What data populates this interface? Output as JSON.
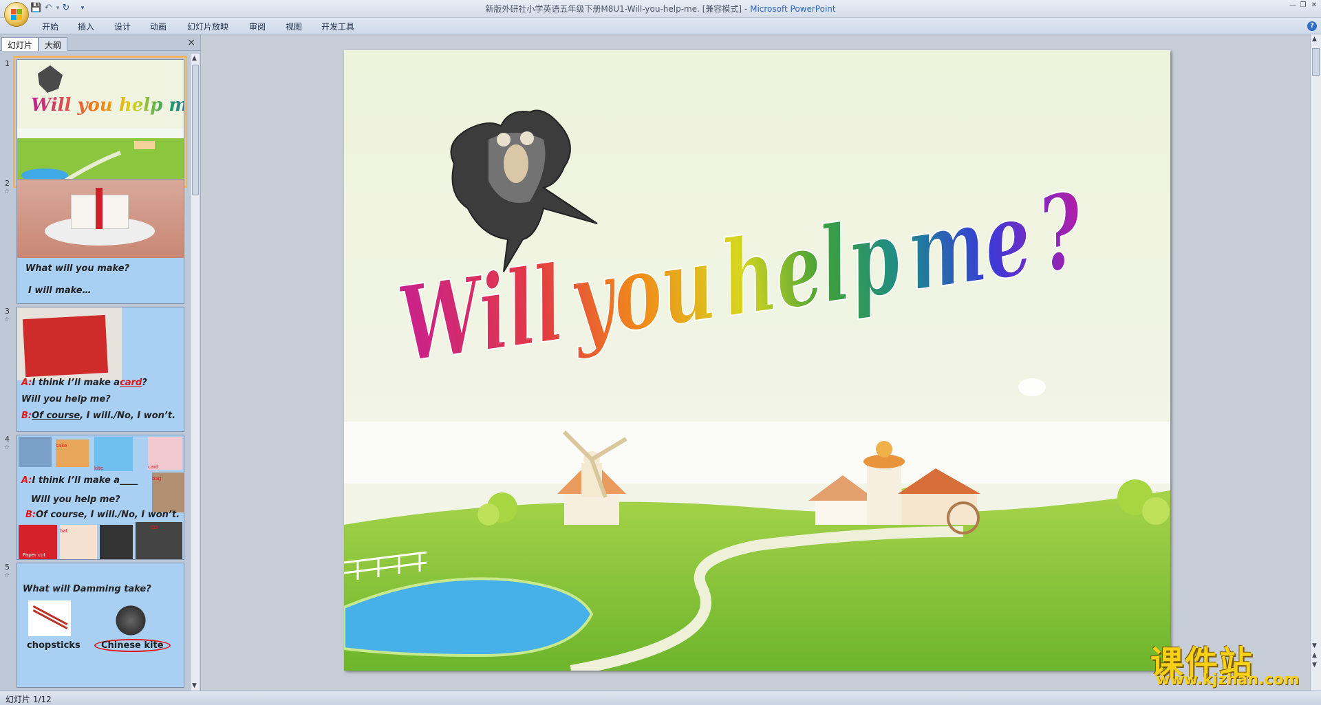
{
  "titlebar": {
    "doc_title": "新版外研社小学英语五年级下册M8U1-Will-you-help-me. [兼容模式]",
    "separator": "-",
    "app_name": "Microsoft PowerPoint"
  },
  "ribbon_tabs": [
    "开始",
    "插入",
    "设计",
    "动画",
    "幻灯片放映",
    "审阅",
    "视图",
    "开发工具"
  ],
  "panel": {
    "tabs": [
      "幻灯片",
      "大纲"
    ],
    "close": "×"
  },
  "thumbnails": [
    {
      "num": "1",
      "title": "Will you help me ?"
    },
    {
      "num": "2",
      "lines": [
        "What will you make?",
        "I will make…"
      ]
    },
    {
      "num": "3",
      "line1_label": "A:",
      "line1": "I think I’ll make a",
      "blank": "card",
      "line1_end": "?",
      "line2": "Will you help me?",
      "line3_label": "B:",
      "line3_u": "Of course",
      "line3": ", I will./No, I won’t."
    },
    {
      "num": "4",
      "line1_label": "A:",
      "line1": "I think I’ll make a____",
      "line2": "Will you help me?",
      "line3_label": "B:",
      "line3": "Of course, I will./No, I won’t.",
      "tags": [
        "cake",
        "kite",
        "card",
        "bag",
        "hat",
        "CD",
        "Paper cut"
      ]
    },
    {
      "num": "5",
      "question": "What will Damming take?",
      "items": [
        "chopsticks",
        "Chinese kite"
      ]
    }
  ],
  "slide": {
    "title_words": [
      "Will",
      "you",
      "help",
      "me",
      "?"
    ]
  },
  "statusbar": {
    "text": "幻灯片 1/12"
  },
  "watermark": {
    "cn": "课件站",
    "url": "www.kjzhan.com"
  },
  "colors": {
    "accent": "#2e66b8",
    "selection": "#f3b45a",
    "thumb_bg": "#a9cff3",
    "watermark": "#f7d01a"
  }
}
